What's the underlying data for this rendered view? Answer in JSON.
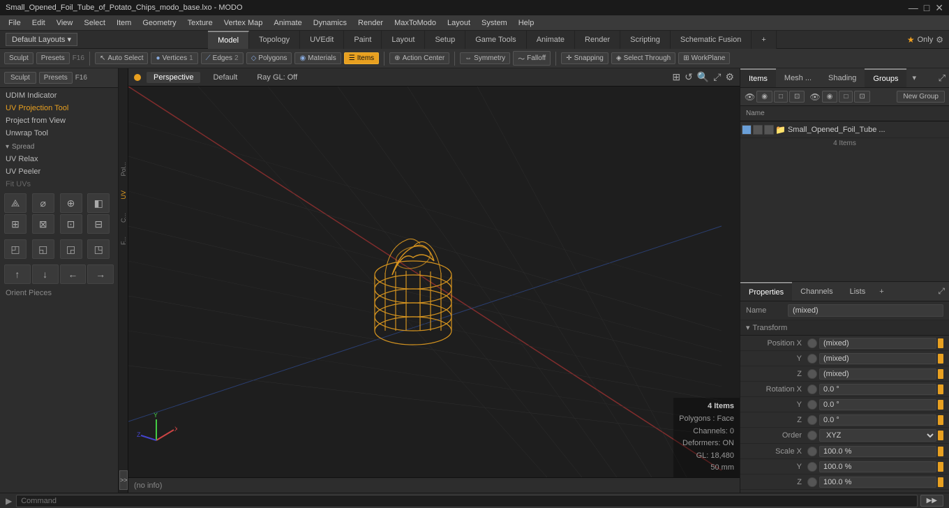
{
  "titlebar": {
    "title": "Small_Opened_Foil_Tube_of_Potato_Chips_modo_base.lxo - MODO",
    "minimize": "—",
    "maximize": "□",
    "close": "✕"
  },
  "menubar": {
    "items": [
      "File",
      "Edit",
      "View",
      "Select",
      "Item",
      "Geometry",
      "Texture",
      "Vertex Map",
      "Animate",
      "Dynamics",
      "Render",
      "MaxToModo",
      "Layout",
      "System",
      "Help"
    ]
  },
  "layout": {
    "selector": "Default Layouts ▾",
    "tabs": [
      "Model",
      "Topology",
      "UVEdit",
      "Paint",
      "Layout",
      "Setup",
      "Game Tools",
      "Animate",
      "Render",
      "Scripting",
      "Schematic Fusion"
    ],
    "active_tab": "Model",
    "only_label": "Only",
    "gear_icon": "⚙"
  },
  "toolbar": {
    "sculpt": "Sculpt",
    "presets": "Presets",
    "f16": "F16",
    "auto_select": "Auto Select",
    "vertices": "Vertices",
    "vertices_count": "1",
    "edges": "Edges",
    "edges_count": "2",
    "polygons": "Polygons",
    "materials": "Materials",
    "items": "Items",
    "action_center": "Action Center",
    "symmetry": "Symmetry",
    "falloff": "Falloff",
    "snapping": "Snapping",
    "select_through": "Select Through",
    "workplane": "WorkPlane"
  },
  "left_panel": {
    "udim_indicator": "UDIM Indicator",
    "uv_projection_tool": "UV Projection Tool",
    "project_from_view": "Project from View",
    "unwrap_tool": "Unwrap Tool",
    "spread_label": "Spread",
    "uv_relax": "UV Relax",
    "uv_peeler": "UV Peeler",
    "fit_uvs": "Fit UVs",
    "orient_pieces": "Orient Pieces",
    "strips": [
      "Pol...",
      "C...",
      "UV",
      "F..."
    ]
  },
  "viewport": {
    "perspective": "Perspective",
    "default": "Default",
    "ray_gl": "Ray GL: Off",
    "no_info": "(no info)"
  },
  "viewport_info": {
    "items": "4 Items",
    "polygons": "Polygons : Face",
    "channels": "Channels: 0",
    "deformers": "Deformers: ON",
    "gl": "GL: 18,480",
    "size": "50 mm"
  },
  "items_panel": {
    "new_group": "New Group",
    "name_col": "Name",
    "item_name": "Small_Opened_Foil_Tube ...",
    "item_count": "4 Items"
  },
  "properties": {
    "tabs": [
      "Properties",
      "Channels",
      "Lists"
    ],
    "active_tab": "Properties",
    "name_label": "Name",
    "name_value": "(mixed)",
    "transform_section": "Transform",
    "position_x_label": "Position X",
    "position_x_value": "(mixed)",
    "position_y_label": "Y",
    "position_y_value": "(mixed)",
    "position_z_label": "Z",
    "position_z_value": "(mixed)",
    "rotation_x_label": "Rotation X",
    "rotation_x_value": "0.0 °",
    "rotation_y_label": "Y",
    "rotation_y_value": "0.0 °",
    "rotation_z_label": "Z",
    "rotation_z_value": "0.0 °",
    "order_label": "Order",
    "order_value": "XYZ",
    "scale_x_label": "Scale X",
    "scale_x_value": "100.0 %",
    "scale_y_label": "Y",
    "scale_y_value": "100.0 %",
    "scale_z_label": "Z",
    "scale_z_value": "100.0 %"
  },
  "command_bar": {
    "arrow": "▶",
    "placeholder": "Command",
    "run_btn": "▶▶"
  }
}
